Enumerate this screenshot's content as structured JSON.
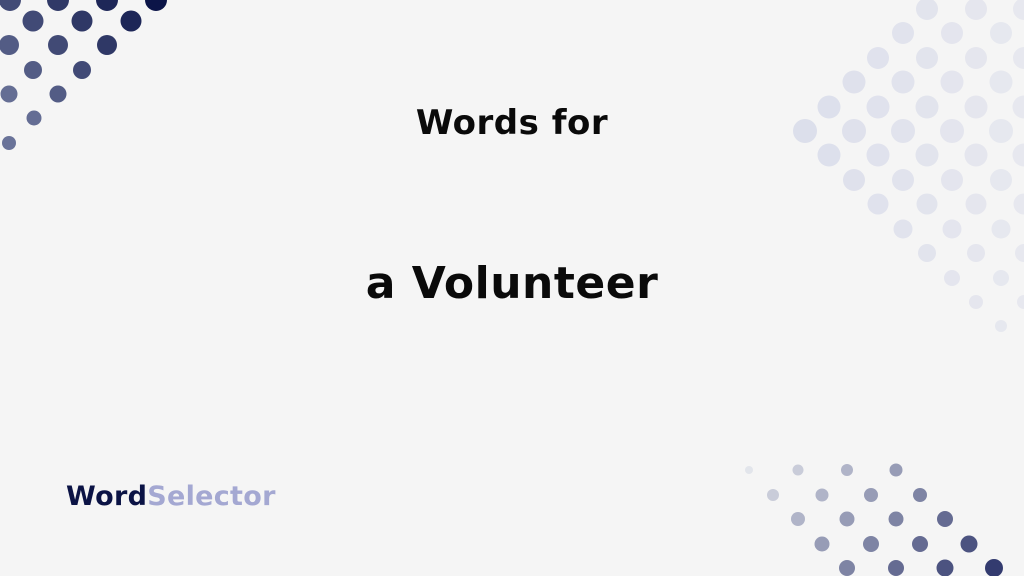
{
  "slide": {
    "heading_line1": "Words for",
    "heading_line2": "a Volunteer"
  },
  "logo": {
    "part1": "Word",
    "part2": "Selector"
  },
  "colors": {
    "background": "#f5f5f5",
    "title_text": "#0a0a0a",
    "logo_dark": "#0b1345",
    "logo_light": "#a4a8d2",
    "dots_dark": "#0b1447",
    "dots_light": "#e1e3ed"
  }
}
